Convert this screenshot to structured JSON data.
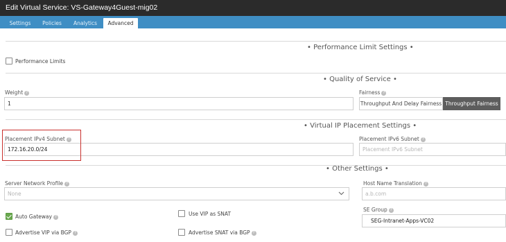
{
  "window": {
    "title": "Edit Virtual Service: VS-Gateway4Guest-mig02"
  },
  "tabs": [
    {
      "label": "Settings"
    },
    {
      "label": "Policies"
    },
    {
      "label": "Analytics"
    },
    {
      "label": "Advanced"
    }
  ],
  "performance": {
    "title": "• Performance Limit Settings •",
    "checkbox_label": "Performance Limits"
  },
  "qos": {
    "title": "• Quality of Service •",
    "weight_label": "Weight",
    "weight_value": "1",
    "fairness_label": "Fairness",
    "fairness_options": [
      "Throughput And Delay Fairness",
      "Throughput Fairness"
    ]
  },
  "vip": {
    "title": "• Virtual IP Placement Settings •",
    "ipv4_label": "Placement IPv4 Subnet",
    "ipv4_value": "172.16.20.0/24",
    "ipv6_label": "Placement IPv6 Subnet",
    "ipv6_placeholder": "Placement IPv6 Subnet"
  },
  "other": {
    "title": "• Other Settings •",
    "network_profile_label": "Server Network Profile",
    "network_profile_value": "None",
    "host_name_label": "Host Name Translation",
    "host_name_placeholder": "a.b.com",
    "auto_gateway_label": "Auto Gateway",
    "use_vip_snat_label": "Use VIP as SNAT",
    "se_group_label": "SE Group",
    "se_group_value": "SEG-Intranet-Apps-VC02",
    "advertise_vip_label": "Advertise VIP via BGP",
    "advertise_snat_label": "Advertise SNAT via BGP"
  }
}
